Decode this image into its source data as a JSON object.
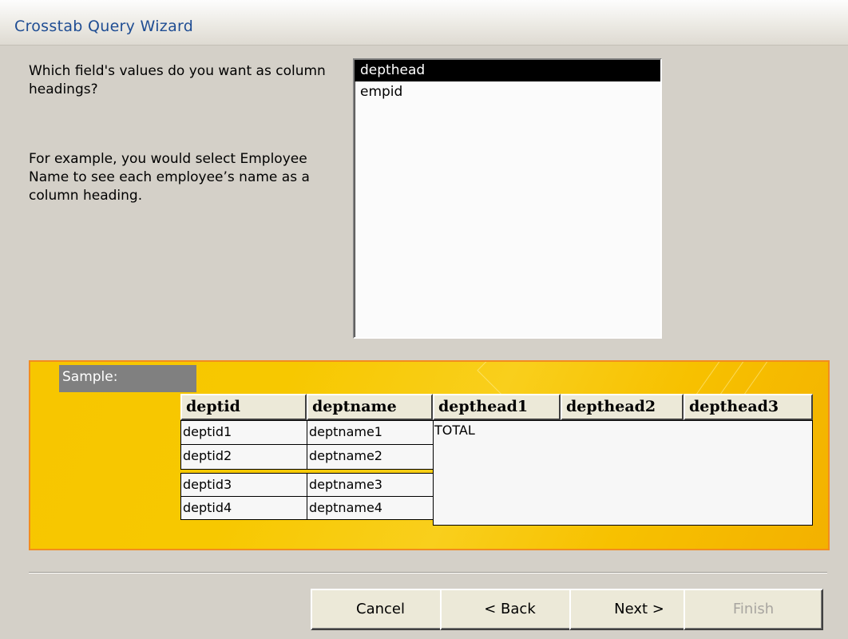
{
  "window": {
    "title": "Crosstab Query Wizard"
  },
  "prompt": {
    "question": "Which field's values do you want as column headings?",
    "example": "For example, you would select Employee Name to see each employee’s name as a column heading."
  },
  "field_list": {
    "items": [
      "depthead",
      "empid"
    ],
    "selected": "depthead"
  },
  "sample": {
    "label": "Sample:",
    "headers": [
      "deptid",
      "deptname",
      "depthead1",
      "depthead2",
      "depthead3"
    ],
    "rows": [
      [
        "deptid1",
        "deptname1"
      ],
      [
        "deptid2",
        "deptname2"
      ],
      [
        "deptid3",
        "deptname3"
      ],
      [
        "deptid4",
        "deptname4"
      ]
    ],
    "total_label": "TOTAL"
  },
  "buttons": {
    "cancel": "Cancel",
    "back": "< Back",
    "next": "Next >",
    "finish": "Finish"
  }
}
